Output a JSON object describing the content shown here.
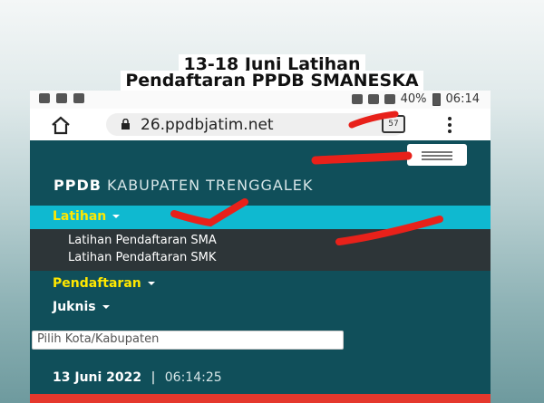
{
  "caption": {
    "line1": "13-18 Juni Latihan",
    "line2": "Pendaftaran PPDB SMANESKA"
  },
  "status_bar": {
    "battery": "40%",
    "time": "06:14"
  },
  "browser": {
    "url": "26.ppdbjatim.net",
    "tab_count": "57"
  },
  "site": {
    "brand_bold": "PPDB",
    "brand_rest": "KABUPATEN TRENGGALEK",
    "menu": {
      "active_label": "Latihan",
      "dropdown": [
        "Latihan Pendaftaran SMA",
        "Latihan Pendaftaran SMK"
      ],
      "pendaftaran": "Pendaftaran",
      "juknis": "Juknis"
    },
    "select_placeholder": "Pilih Kota/Kabupaten",
    "date": "13 Juni 2022",
    "separator": "|",
    "time": "06:14:25"
  },
  "colors": {
    "header_bg": "#104f5a",
    "active_menu_bg": "#0fb9d0",
    "active_text": "#ffe800",
    "annotation_red": "#e8211a"
  }
}
